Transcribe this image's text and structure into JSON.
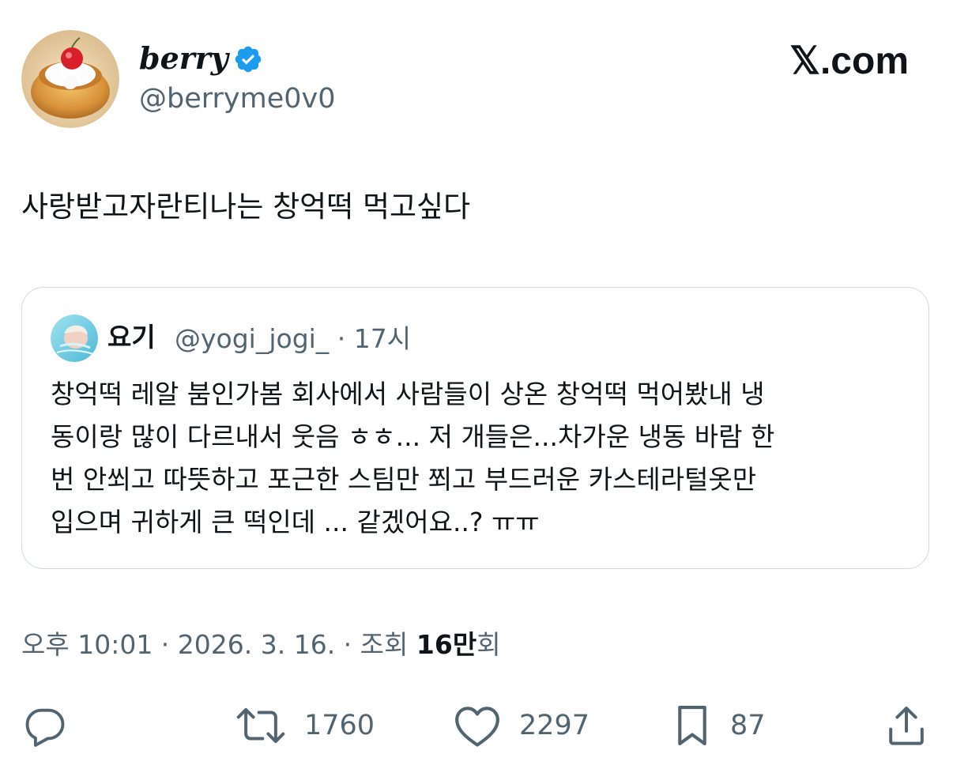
{
  "author": {
    "display_name": "berry",
    "handle": "@berryme0v0",
    "verified": true
  },
  "brand": "𝕏.com",
  "tweet": {
    "text": "사랑받고자란티나는 창억떡 먹고싶다"
  },
  "quote": {
    "name": "요기",
    "handle_time": "@yogi_jogi_ · 17시",
    "lines": [
      "창억떡 레알 붐인가봄 회사에서 사람들이 상온 창억떡 먹어봤내 냉",
      "동이랑 많이 다르내서 웃음 ㅎㅎ... 저 개들은...차가운 냉동 바람 한",
      "번 안쐬고 따뜻하고 포근한 스팀만 쬐고 부드러운 카스테라털옷만",
      "입으며 귀하게 큰 떡인데 ... 같겠어요..? ㅠㅠ"
    ]
  },
  "meta": {
    "time_date": "오후 10:01 · 2026. 3. 16. · 조회 ",
    "views_number": "16만",
    "views_suffix": "회"
  },
  "actions": {
    "reply_icon": "reply-icon",
    "retweet_icon": "retweet-icon",
    "retweets": "1760",
    "like_icon": "heart-icon",
    "likes": "2297",
    "bookmark_icon": "bookmark-icon",
    "bookmarks": "87",
    "share_icon": "share-icon"
  },
  "colors": {
    "text": "#0f1419",
    "secondary": "#536471",
    "border": "#cfd9de",
    "verified": "#1d9bf0"
  }
}
